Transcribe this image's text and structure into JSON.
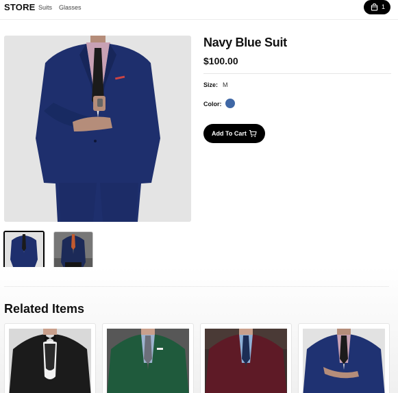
{
  "header": {
    "logo": "STORE",
    "nav": [
      "Suits",
      "Glasses"
    ],
    "cart_count": "1"
  },
  "product": {
    "title": "Navy Blue Suit",
    "price": "$100.00",
    "size_label": "Size:",
    "size_value": "M",
    "color_label": "Color:",
    "color_value": "#3f67a5",
    "add_to_cart": "Add To Cart"
  },
  "related": {
    "title": "Related Items",
    "items": [
      {
        "name": "black-tuxedo",
        "color": "#1b1b1b"
      },
      {
        "name": "green-suit",
        "color": "#1f5a3c"
      },
      {
        "name": "burgundy-suit",
        "color": "#5e1a26"
      },
      {
        "name": "navy-suit",
        "color": "#1f3272"
      }
    ]
  },
  "colors": {
    "accent": "#000000",
    "navy": "#1f3272"
  }
}
